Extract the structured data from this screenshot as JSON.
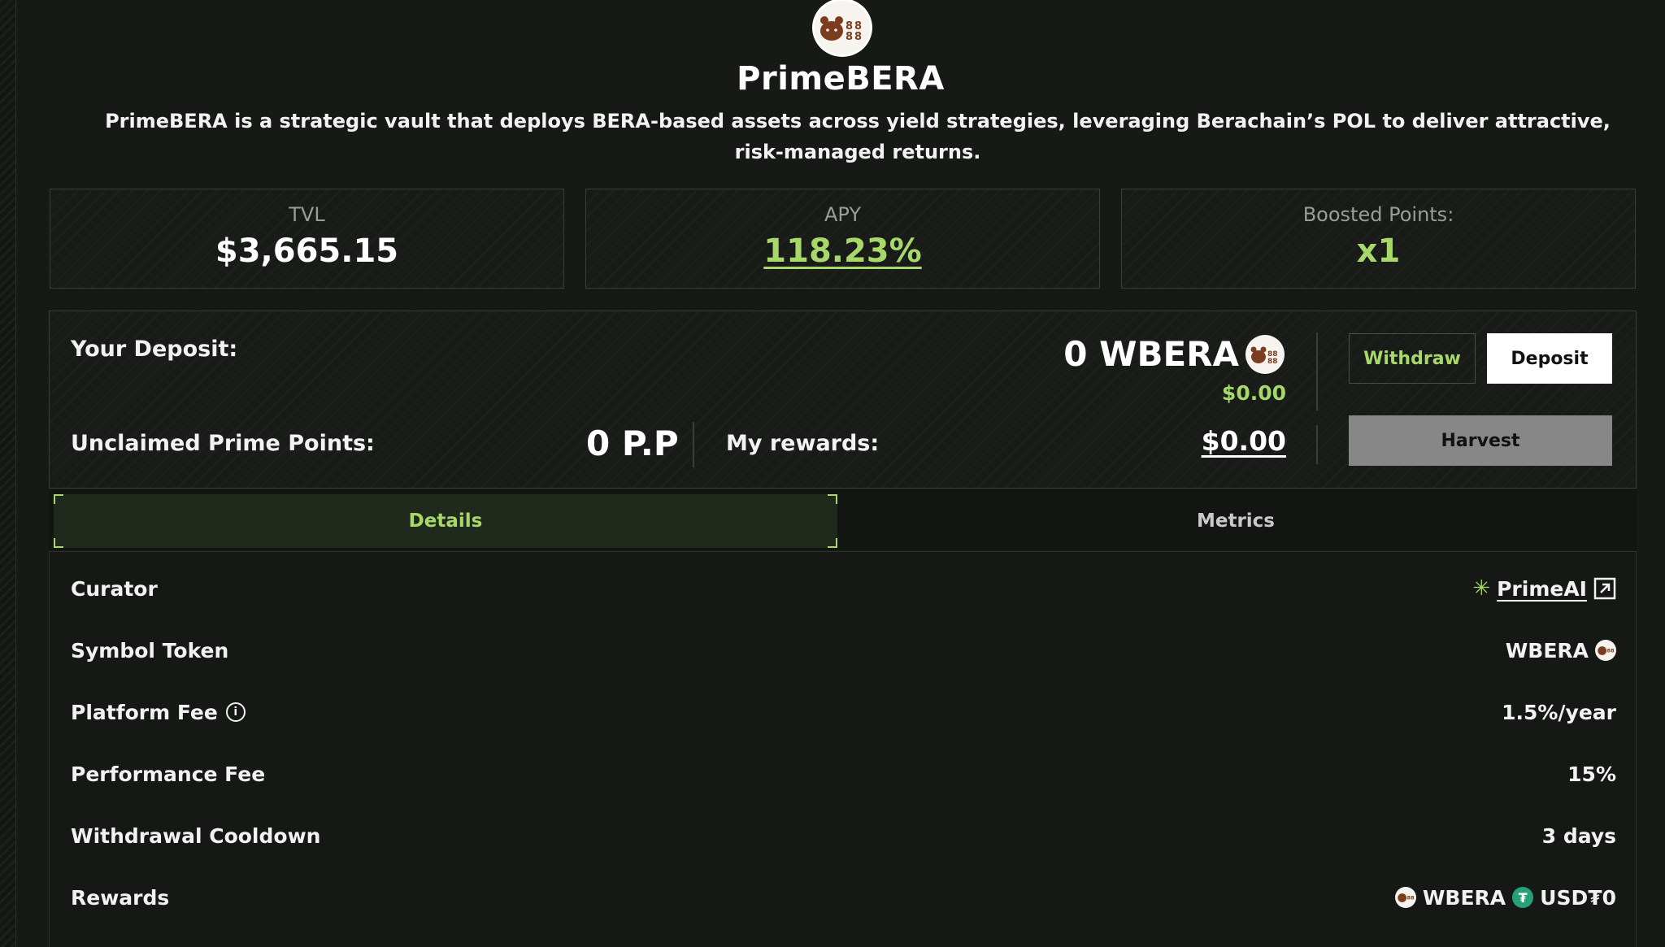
{
  "vault": {
    "title": "PrimeBERA",
    "description": "PrimeBERA is a strategic vault that deploys BERA-based assets across yield strategies, leveraging Berachain’s POL to deliver attractive, risk-managed returns.",
    "logo_icon": "bear-logo-icon"
  },
  "stats": {
    "tvl_label": "TVL",
    "tvl_value": "$3,665.15",
    "apy_label": "APY",
    "apy_value": "118.23%",
    "boost_label": "Boosted Points:",
    "boost_value": "x1"
  },
  "deposit": {
    "your_deposit_label": "Your Deposit:",
    "amount": "0 WBERA",
    "usd": "$0.00",
    "unclaimed_label": "Unclaimed Prime Points:",
    "unclaimed_value": "0 P.P",
    "rewards_label": "My rewards:",
    "rewards_value": "$0.00",
    "withdraw_label": "Withdraw",
    "deposit_label": "Deposit",
    "harvest_label": "Harvest"
  },
  "tabs": [
    {
      "label": "Details",
      "active": true
    },
    {
      "label": "Metrics",
      "active": false
    }
  ],
  "details": {
    "curator_label": "Curator",
    "curator_value": "PrimeAI",
    "symbol_label": "Symbol Token",
    "symbol_value": "WBERA",
    "platform_fee_label": "Platform Fee",
    "platform_fee_value": "1.5%/year",
    "performance_fee_label": "Performance Fee",
    "performance_fee_value": "15%",
    "cooldown_label": "Withdrawal Cooldown",
    "cooldown_value": "3 days",
    "rewards_label": "Rewards",
    "rewards_token_1": "WBERA",
    "rewards_token_2": "USD₮0"
  },
  "colors": {
    "accent_green": "#a8d86a",
    "background": "#161916",
    "tether": "#26a17b"
  }
}
